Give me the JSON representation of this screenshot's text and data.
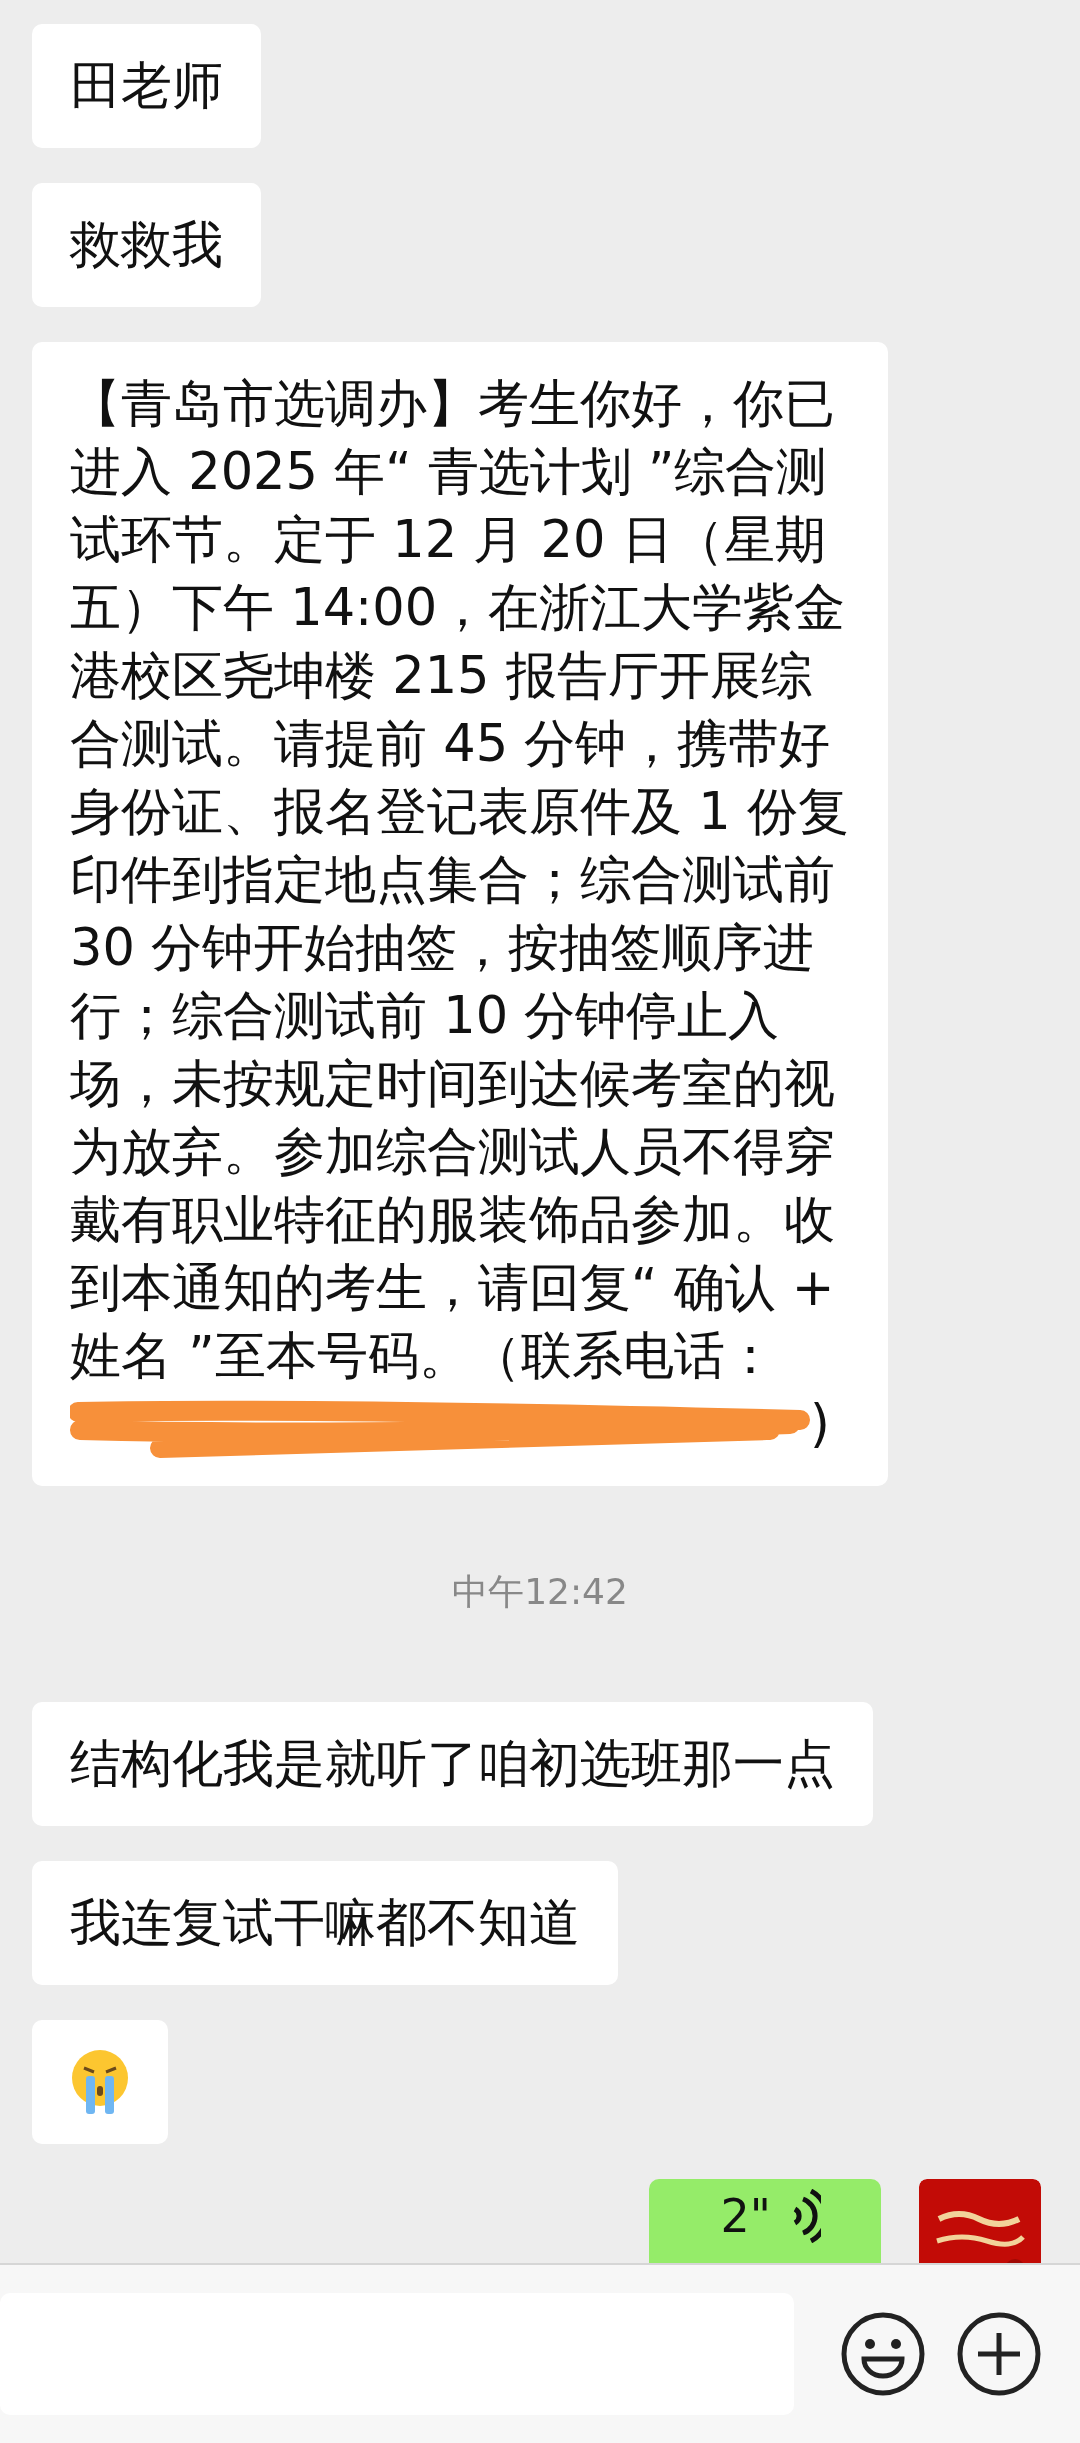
{
  "messages": [
    {
      "kind": "text",
      "outgoing": false,
      "text": "田老师"
    },
    {
      "kind": "text",
      "outgoing": false,
      "text": "救救我"
    },
    {
      "kind": "text",
      "outgoing": false,
      "text": "【青岛市选调办】考生你好，你已进入 2025 年“ 青选计划 ”综合测试环节。定于 12 月 20 日（星期五）下午 14:00，在浙江大学紫金港校区尧坤楼 215 报告厅开展综合测试。请提前 45 分钟，携带好身份证、报名登记表原件及 1 份复印件到指定地点集合；综合测试前 30 分钟开始抽签，按抽签顺序进行；综合测试前 10 分钟停止入场，未按规定时间到达候考室的视为放弃。参加综合测试人员不得穿戴有职业特征的服装饰品参加。收到本通知的考生，请回复“ 确认 + 姓名 ”至本号码。（联系电话：",
      "redacted": true,
      "tail": ")"
    },
    {
      "kind": "time",
      "text": "中午12:42"
    },
    {
      "kind": "text",
      "outgoing": false,
      "text": "结构化我是就听了咱初选班那一点"
    },
    {
      "kind": "text",
      "outgoing": false,
      "text": "我连复试干嘛都不知道"
    },
    {
      "kind": "emoji",
      "outgoing": false
    },
    {
      "kind": "voice",
      "outgoing": true,
      "duration": "2\""
    }
  ]
}
